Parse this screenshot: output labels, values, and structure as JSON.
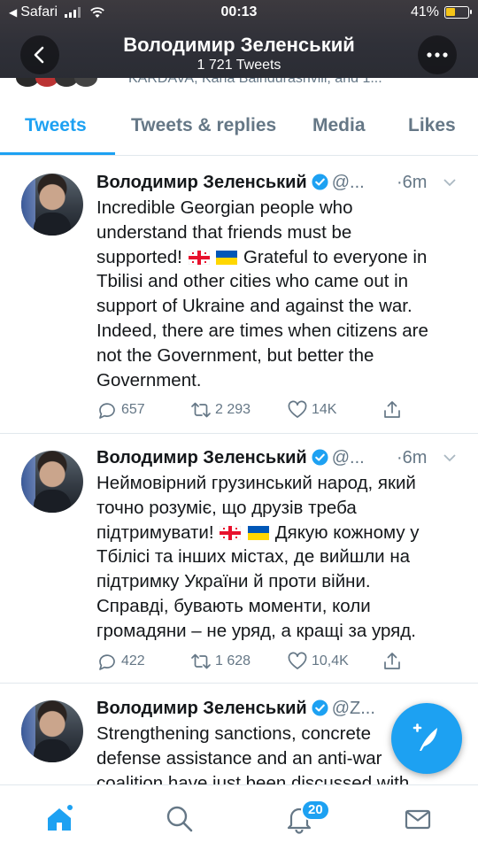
{
  "status_bar": {
    "back_app": "Safari",
    "time": "00:13",
    "battery": "41%"
  },
  "header": {
    "title": "Володимир Зеленський",
    "subtitle": "1 721 Tweets",
    "peek_text": "KARDAVA, Kana Baindurashvili, and 1..."
  },
  "tabs": [
    {
      "label": "Tweets",
      "active": true
    },
    {
      "label": "Tweets & replies",
      "active": false
    },
    {
      "label": "Media",
      "active": false
    },
    {
      "label": "Likes",
      "active": false
    }
  ],
  "tweets": [
    {
      "name": "Володимир Зеленський",
      "handle": "@...",
      "time": "·6m",
      "lines": [
        "Incredible Georgian people who",
        "understand that friends must be",
        "supported!",
        "Grateful to everyone in",
        "Tbilisi and other cities who came out in",
        "support of Ukraine and against the war.",
        "Indeed, there are times when citizens are",
        "not the Government, but better the",
        "Government."
      ],
      "replies": "657",
      "retweets": "2 293",
      "likes": "14K"
    },
    {
      "name": "Володимир Зеленський",
      "handle": "@...",
      "time": "·6m",
      "lines": [
        "Неймовірний грузинський народ, який",
        "точно розуміє, що друзів треба",
        "підтримувати!",
        "Дякую кожному у",
        "Тбілісі та інших містах, де вийшли на",
        "підтримку України й проти війни.",
        "Справді, бувають моменти, коли",
        "громадяни – не уряд, а кращі за уряд."
      ],
      "replies": "422",
      "retweets": "1 628",
      "likes": "10,4K"
    },
    {
      "name": "Володимир Зеленський",
      "handle": "@Z...",
      "lines": [
        "Strengthening sanctions, concrete",
        "defense assistance and an anti-war",
        "coalition have just been discussed with"
      ]
    }
  ],
  "bottom_nav": {
    "notifications_badge": "20"
  },
  "colors": {
    "accent": "#1da1f2",
    "text": "#14171a",
    "muted": "#657786",
    "header_bg": "#2f3038"
  }
}
